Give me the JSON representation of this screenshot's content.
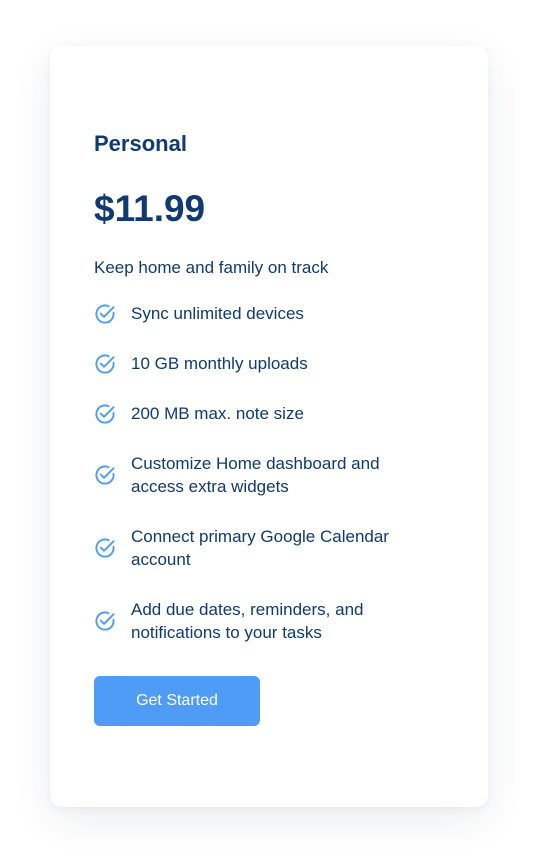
{
  "plan": {
    "name": "Personal",
    "price": "$11.99",
    "tagline": "Keep home and family on track"
  },
  "features": [
    {
      "label": "Sync unlimited devices",
      "icon": "check-circle-icon"
    },
    {
      "label": "10 GB monthly uploads",
      "icon": "check-circle-icon"
    },
    {
      "label": "200 MB max. note size",
      "icon": "check-circle-icon"
    },
    {
      "label": "Customize Home dashboard and access extra widgets",
      "icon": "check-circle-icon"
    },
    {
      "label": "Connect primary Google Calendar account",
      "icon": "check-circle-icon"
    },
    {
      "label": "Add due dates, reminders, and notifications to your tasks",
      "icon": "check-circle-icon"
    }
  ],
  "cta": {
    "label": "Get Started"
  },
  "colors": {
    "text": "#0f3a73",
    "accent": "#4f9cf7",
    "button_text": "#ffffff",
    "card_background": "#ffffff"
  }
}
